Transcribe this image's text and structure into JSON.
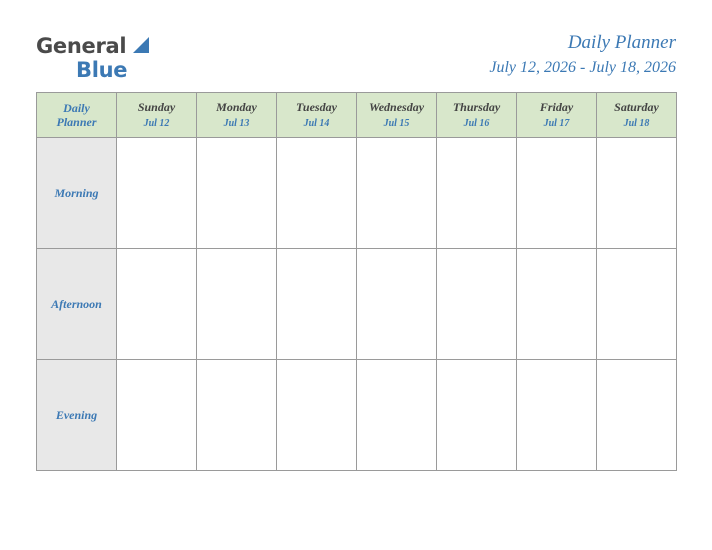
{
  "brand": {
    "name_part1": "General",
    "name_part2": "Blue",
    "accent_color": "#3c79b4",
    "text_color": "#4a4a4a"
  },
  "header": {
    "title": "Daily Planner",
    "date_range": "July 12, 2026 - July 18, 2026"
  },
  "table": {
    "corner_label_line1": "Daily",
    "corner_label_line2": "Planner",
    "header_bg": "#d8e7cb",
    "row_label_bg": "#e8e8e8",
    "columns": [
      {
        "day": "Sunday",
        "date": "Jul 12"
      },
      {
        "day": "Monday",
        "date": "Jul 13"
      },
      {
        "day": "Tuesday",
        "date": "Jul 14"
      },
      {
        "day": "Wednesday",
        "date": "Jul 15"
      },
      {
        "day": "Thursday",
        "date": "Jul 16"
      },
      {
        "day": "Friday",
        "date": "Jul 17"
      },
      {
        "day": "Saturday",
        "date": "Jul 18"
      }
    ],
    "rows": [
      {
        "label": "Morning",
        "cells": [
          "",
          "",
          "",
          "",
          "",
          "",
          ""
        ]
      },
      {
        "label": "Afternoon",
        "cells": [
          "",
          "",
          "",
          "",
          "",
          "",
          ""
        ]
      },
      {
        "label": "Evening",
        "cells": [
          "",
          "",
          "",
          "",
          "",
          "",
          ""
        ]
      }
    ]
  }
}
